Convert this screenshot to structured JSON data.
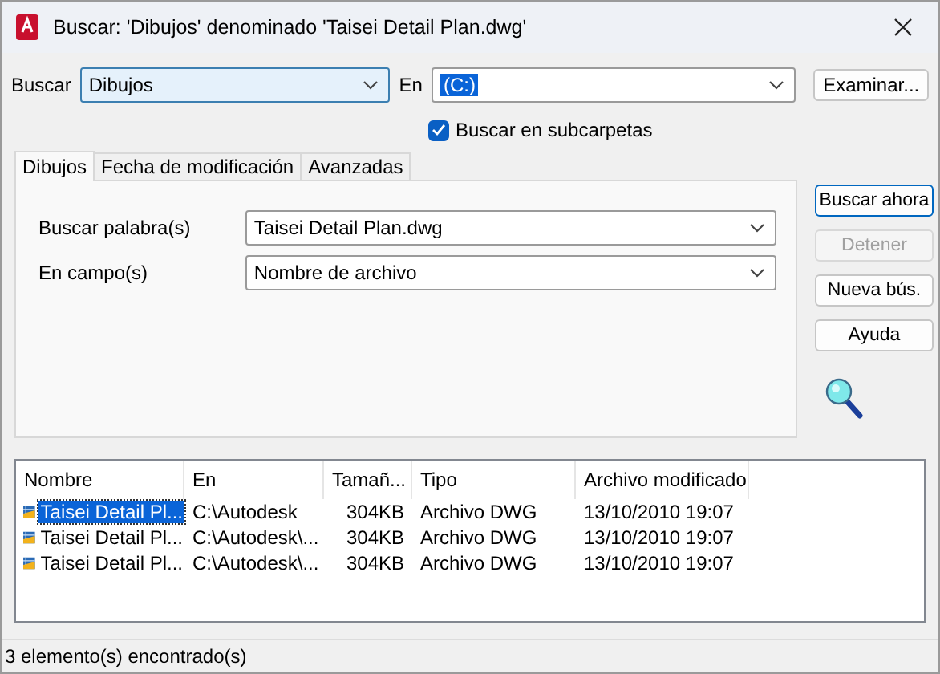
{
  "window": {
    "title": "Buscar: 'Dibujos' denominado 'Taisei Detail Plan.dwg'"
  },
  "search_bar": {
    "type_label": "Buscar",
    "type_value": "Dibujos",
    "in_label": "En",
    "in_value": "(C:)",
    "browse_button": "Examinar..."
  },
  "subfolders": {
    "label": "Buscar en subcarpetas",
    "checked": true
  },
  "tabs": [
    {
      "label": "Dibujos",
      "selected": true
    },
    {
      "label": "Fecha de modificación",
      "selected": false
    },
    {
      "label": "Avanzadas",
      "selected": false
    }
  ],
  "fields": [
    {
      "label": "Buscar palabra(s)",
      "value": "Taisei Detail Plan.dwg"
    },
    {
      "label": "En campo(s)",
      "value": "Nombre de archivo"
    }
  ],
  "actions": [
    {
      "label": "Buscar ahora",
      "disabled": false,
      "default": true
    },
    {
      "label": "Detener",
      "disabled": true,
      "default": false
    },
    {
      "label": "Nueva bús.",
      "disabled": false,
      "default": false
    },
    {
      "label": "Ayuda",
      "disabled": false,
      "default": false
    }
  ],
  "results": {
    "columns": [
      "Nombre",
      "En",
      "Tamañ...",
      "Tipo",
      "Archivo modificado"
    ],
    "rows": [
      {
        "cells": [
          "Taisei Detail Pl...",
          "C:\\Autodesk",
          "304KB",
          "Archivo DWG",
          "13/10/2010 19:07"
        ],
        "selected": true
      },
      {
        "cells": [
          "Taisei Detail Pl...",
          "C:\\Autodesk\\...",
          "304KB",
          "Archivo DWG",
          "13/10/2010 19:07"
        ],
        "selected": false
      },
      {
        "cells": [
          "Taisei Detail Pl...",
          "C:\\Autodesk\\...",
          "304KB",
          "Archivo DWG",
          "13/10/2010 19:07"
        ],
        "selected": false
      }
    ]
  },
  "status_bar": "3 elemento(s) encontrado(s)"
}
